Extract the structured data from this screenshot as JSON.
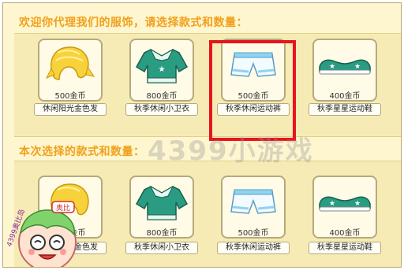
{
  "header": {
    "title_top": "欢迎你代理我们的服饰，请选择款式和数量：",
    "title_bottom": "本次选择的款式和数量："
  },
  "catalog_items": [
    {
      "price": "500金币",
      "name": "休闲阳光金色发",
      "icon": "blonde-hair-icon"
    },
    {
      "price": "800金币",
      "name": "秋季休闲小卫衣",
      "icon": "teal-hoodie-icon"
    },
    {
      "price": "500金币",
      "name": "秋季休闲运动裤",
      "icon": "white-shorts-icon"
    },
    {
      "price": "400金币",
      "name": "秋季星星运动鞋",
      "icon": "star-sneakers-icon"
    }
  ],
  "selected_items": [
    {
      "price": "500金币",
      "name": "休闲阳光金色发",
      "icon": "blonde-hair-icon"
    },
    {
      "price": "800金币",
      "name": "秋季休闲小卫衣",
      "icon": "teal-hoodie-icon"
    },
    {
      "price": "500金币",
      "name": "秋季休闲运动裤",
      "icon": "white-shorts-icon"
    },
    {
      "price": "400金币",
      "name": "秋季星星运动鞋",
      "icon": "star-sneakers-icon"
    }
  ],
  "selection": {
    "selected_index": 2,
    "highlight_color": "#e8141c"
  },
  "watermark": {
    "text": "4399小游戏"
  },
  "mascot": {
    "site_label": "4399奥比岛",
    "tag_label": "奥比"
  },
  "colors": {
    "title": "#f0a020",
    "panel": "#f7ebb5",
    "background": "#fdf6cf",
    "card_border": "#b5a97d"
  }
}
